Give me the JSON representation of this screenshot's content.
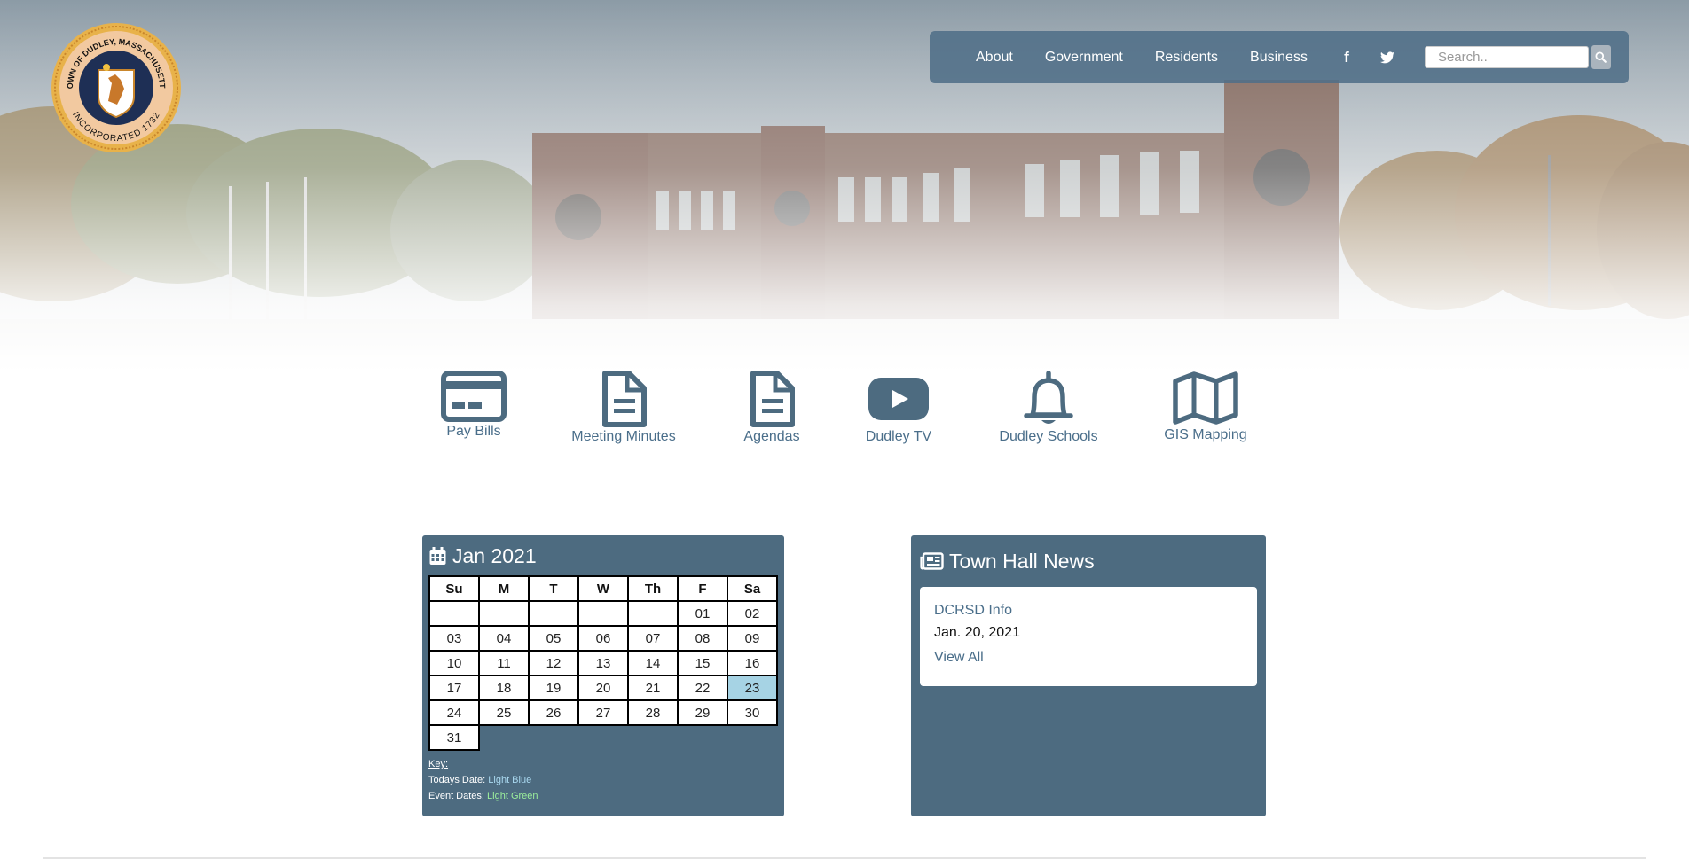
{
  "seal": {
    "top_text": "TOWN OF DUDLEY, MASSACHUSETTS",
    "bottom_text": "INCORPORATED 1732"
  },
  "nav": {
    "items": [
      {
        "label": "About"
      },
      {
        "label": "Government"
      },
      {
        "label": "Residents"
      },
      {
        "label": "Business"
      }
    ],
    "facebook_glyph": "f",
    "twitter_icon": "twitter-icon",
    "search_placeholder": "Search..",
    "search_icon": "search-icon"
  },
  "quick_links": [
    {
      "label": "Pay Bills",
      "icon": "credit-card-icon"
    },
    {
      "label": "Meeting Minutes",
      "icon": "document-icon"
    },
    {
      "label": "Agendas",
      "icon": "document-icon"
    },
    {
      "label": "Dudley TV",
      "icon": "youtube-play-icon"
    },
    {
      "label": "Dudley Schools",
      "icon": "bell-icon"
    },
    {
      "label": "GIS Mapping",
      "icon": "map-icon"
    }
  ],
  "calendar": {
    "title": "Jan 2021",
    "weekdays": [
      "Su",
      "M",
      "T",
      "W",
      "Th",
      "F",
      "Sa"
    ],
    "weeks": [
      [
        "",
        "",
        "",
        "",
        "",
        "01",
        "02"
      ],
      [
        "03",
        "04",
        "05",
        "06",
        "07",
        "08",
        "09"
      ],
      [
        "10",
        "11",
        "12",
        "13",
        "14",
        "15",
        "16"
      ],
      [
        "17",
        "18",
        "19",
        "20",
        "21",
        "22",
        "23"
      ],
      [
        "24",
        "25",
        "26",
        "27",
        "28",
        "29",
        "30"
      ],
      [
        "31"
      ]
    ],
    "today": "23",
    "today_color": "#a6d3e4",
    "key_title": "Key:",
    "key_today_label": "Todays Date:",
    "key_today_value": "Light Blue",
    "key_event_label": "Event Dates:",
    "key_event_value": "Light Green"
  },
  "news": {
    "title": "Town Hall News",
    "items": [
      {
        "title": "DCRSD Info",
        "date": "Jan. 20, 2021"
      }
    ],
    "view_all": "View All"
  },
  "colors": {
    "panel": "#4d6b80",
    "accent": "#4a6e8a",
    "nav_bg": "#506e87"
  }
}
